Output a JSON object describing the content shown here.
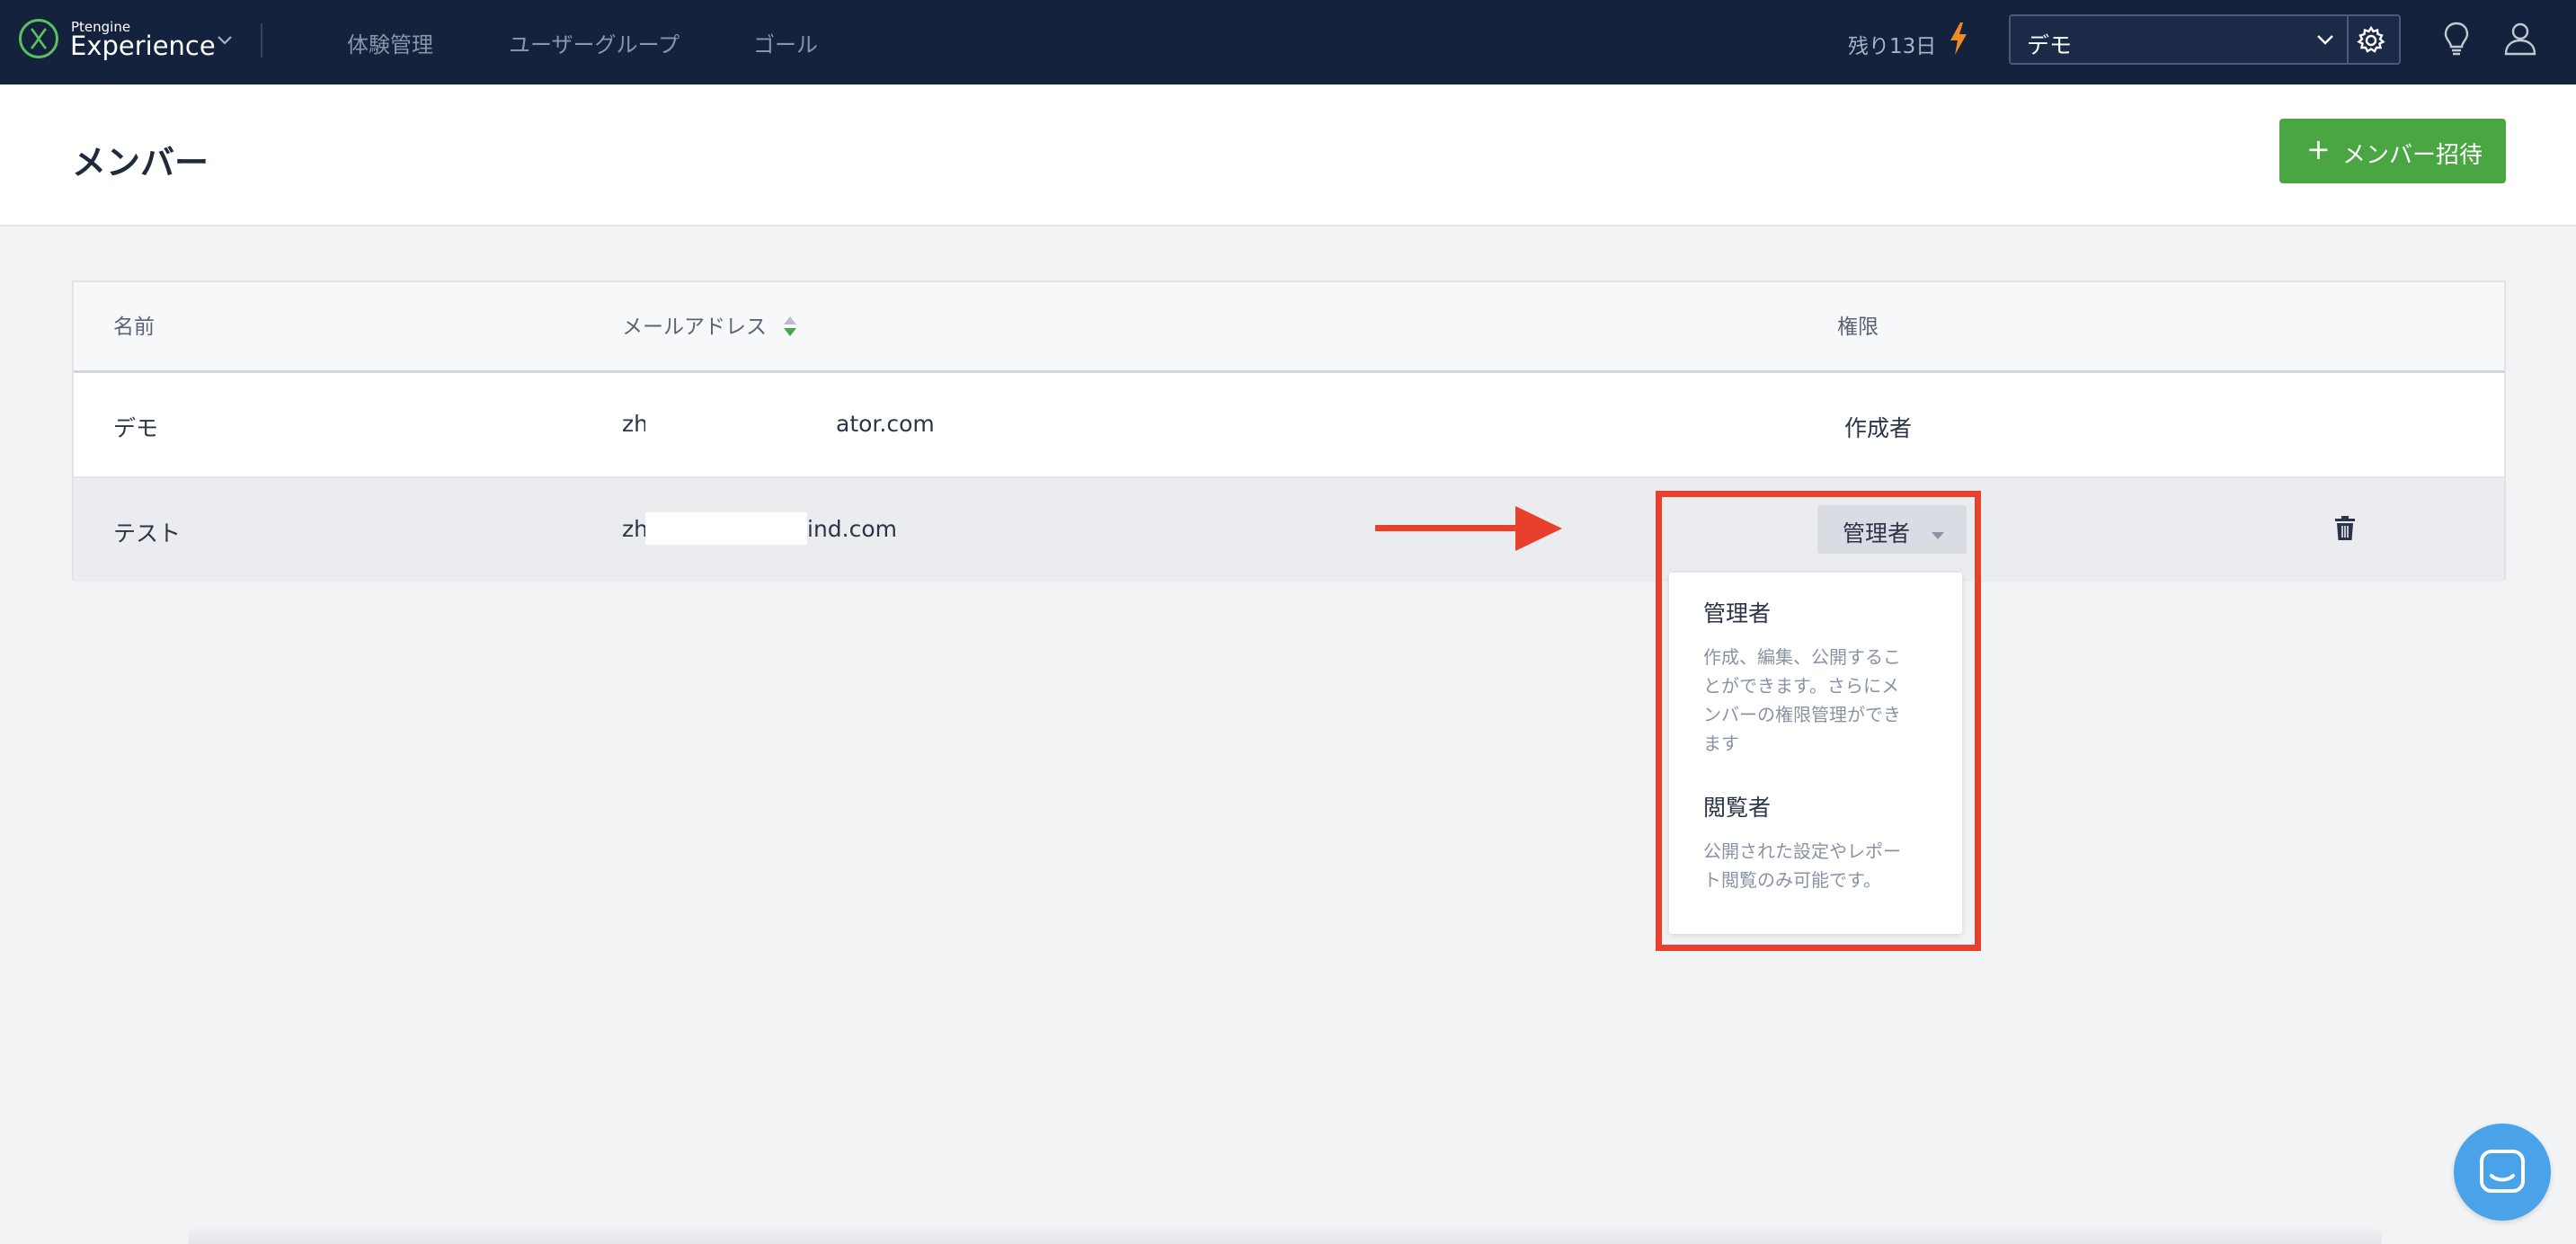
{
  "header": {
    "logo_small": "Ptengine",
    "logo_big": "Experience",
    "nav": [
      "体験管理",
      "ユーザーグループ",
      "ゴール"
    ],
    "trial": "残り13日",
    "project": "デモ",
    "icons": [
      "experience-logo-icon",
      "chevron-down-icon",
      "bolt-icon",
      "gear-icon",
      "lightbulb-icon",
      "user-icon"
    ]
  },
  "page": {
    "title": "メンバー",
    "invite_label": "メンバー招待",
    "invite_icon": "+"
  },
  "table": {
    "columns": [
      "名前",
      "メールアドレス",
      "権限"
    ],
    "rows": [
      {
        "name": "デモ",
        "email_start": "zh",
        "email_end": "ator.com",
        "role": "作成者"
      },
      {
        "name": "テスト",
        "email_start": "zh",
        "email_end": "ind.com",
        "role": "管理者"
      }
    ]
  },
  "dropdown": {
    "options": [
      {
        "title": "管理者",
        "desc": [
          "作成、編集、公開するこ",
          "とができます。さらにメ",
          "ンバーの権限管理ができ",
          "ます"
        ]
      },
      {
        "title": "閲覧者",
        "desc": [
          "公開された設定やレポー",
          "ト閲覧のみ可能です。"
        ]
      }
    ]
  },
  "colors": {
    "nav_bg": "#14223d",
    "accent_green": "#4aa543",
    "annotation_red": "#e8402c",
    "chat_blue": "#4aa3e8",
    "bolt_orange": "#f08a24"
  }
}
